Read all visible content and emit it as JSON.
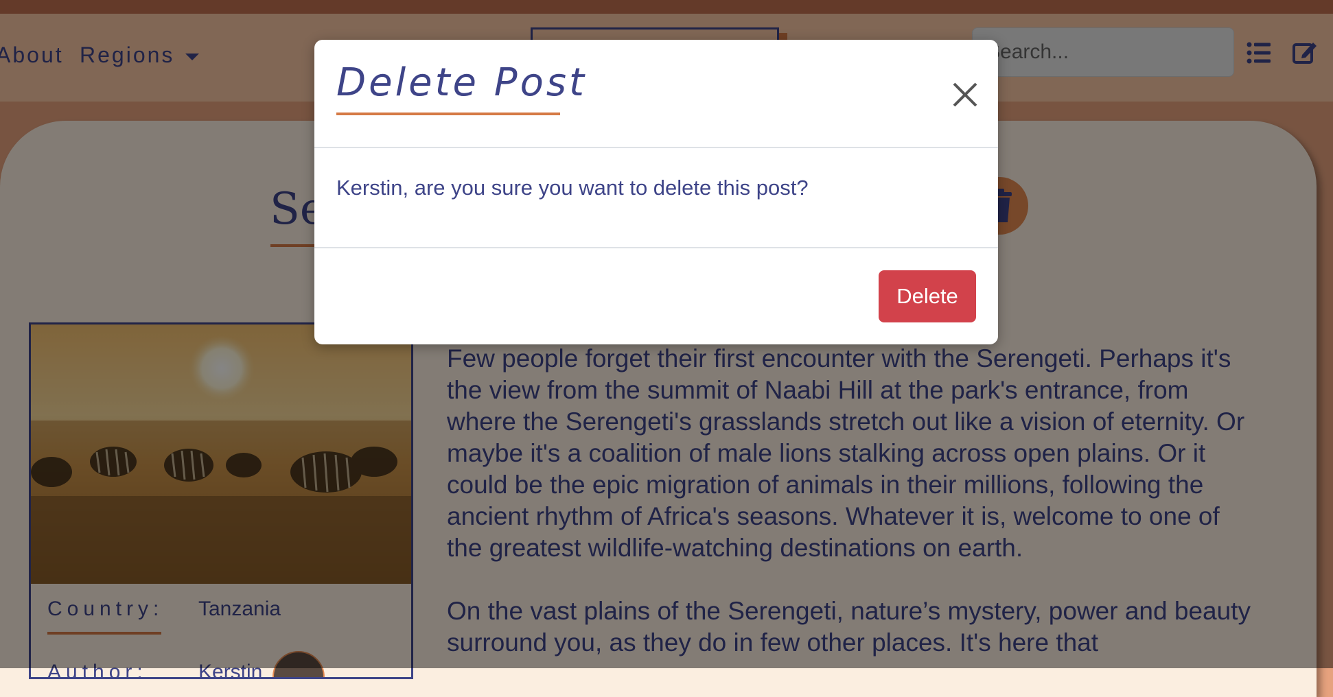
{
  "nav": {
    "about": "About",
    "regions": "Regions",
    "search_placeholder": "Search..."
  },
  "post": {
    "title_visible": "Se",
    "country_label": "Country:",
    "country_value": "Tanzania",
    "author_label": "Author:",
    "author_value": "Kerstin",
    "paragraphs": [
      "Few people forget their first encounter with the Serengeti. Perhaps it's the view from the summit of Naabi Hill at the park's entrance, from where the Serengeti's grasslands stretch out like a vision of eternity. Or maybe it's a coalition of male lions stalking across open plains. Or it could be the epic migration of animals in their millions, following the ancient rhythm of Africa's seasons. Whatever it is, welcome to one of the greatest wildlife-watching destinations on earth.",
      "On the vast plains of the Serengeti, nature’s mystery, power and beauty surround you, as they do in few other places. It's here that"
    ]
  },
  "modal": {
    "title": "Delete Post",
    "message": "Kerstin, are you sure you want to delete this post?",
    "delete_label": "Delete"
  },
  "colors": {
    "primary_text": "#3e4488",
    "accent": "#d57a45",
    "danger": "#d2424b",
    "nav_bg": "#f8c5a4",
    "card_bg": "#fbeee0"
  },
  "icons": {
    "list": "list-icon",
    "edit": "edit-icon",
    "trash": "trash-icon",
    "close": "close-icon",
    "caret": "caret-down-icon"
  }
}
